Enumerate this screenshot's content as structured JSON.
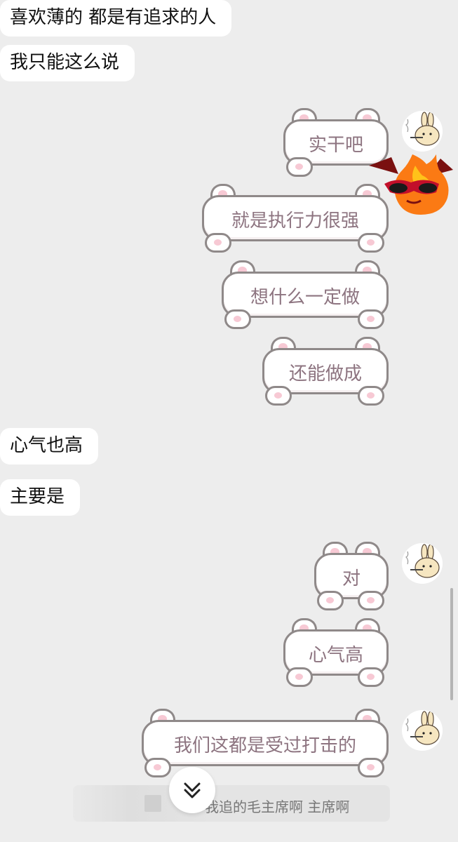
{
  "incoming": [
    {
      "text": "喜欢薄的 都是有追求的人"
    },
    {
      "text": "我只能这么说"
    },
    {
      "text": "心气也高"
    },
    {
      "text": "主要是"
    }
  ],
  "outgoing": [
    {
      "text": "实干吧"
    },
    {
      "text": "就是执行力很强"
    },
    {
      "text": "想什么一定做"
    },
    {
      "text": "还能做成"
    },
    {
      "text": "对"
    },
    {
      "text": "心气高"
    },
    {
      "text": "我们这都是受过打击的"
    }
  ],
  "quote": {
    "text": "我追的毛主席啊 主席啊"
  },
  "icons": {
    "avatar": "bunny-smoking-avatar",
    "sticker": "devil-fire-sunglasses-sticker",
    "scroll_down": "double-chevron-down-icon"
  },
  "colors": {
    "background": "#ededed",
    "bubble_border": "#8f8989",
    "bubble_text": "#8d7480",
    "ear_pink": "#f7c9d4"
  }
}
